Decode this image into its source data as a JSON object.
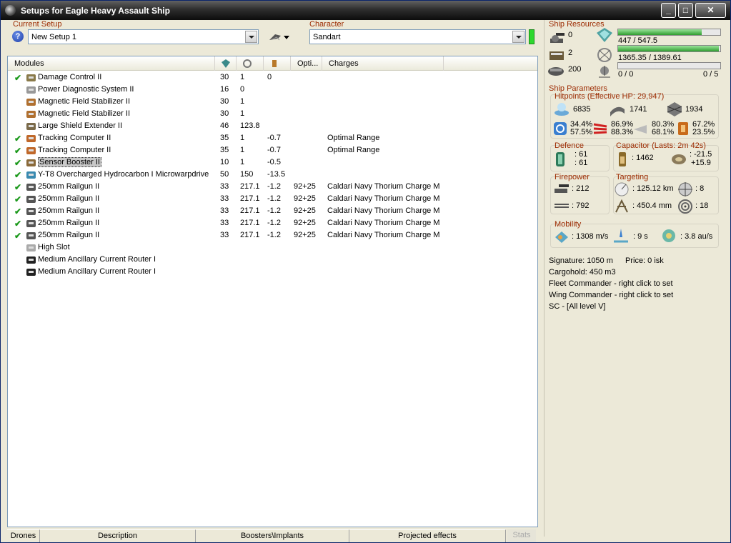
{
  "window": {
    "title": "Setups for Eagle Heavy Assault Ship"
  },
  "setup": {
    "label": "Current Setup",
    "value": "New Setup 1"
  },
  "character": {
    "label": "Character",
    "value": "Sandart"
  },
  "modules": {
    "headers": [
      "Modules",
      "",
      "",
      "",
      "Opti...",
      "Charges"
    ],
    "rows": [
      {
        "active": true,
        "name": "Damage Control II",
        "cpu": "30",
        "pg": "1",
        "cap": "0",
        "opt": "",
        "charge": "",
        "icon": "damage-control-icon"
      },
      {
        "active": false,
        "name": "Power Diagnostic System II",
        "cpu": "16",
        "pg": "0",
        "cap": "",
        "opt": "",
        "charge": "",
        "icon": "power-diagnostic-icon"
      },
      {
        "active": false,
        "name": "Magnetic Field Stabilizer II",
        "cpu": "30",
        "pg": "1",
        "cap": "",
        "opt": "",
        "charge": "",
        "icon": "magnetic-stabilizer-icon"
      },
      {
        "active": false,
        "name": "Magnetic Field Stabilizer II",
        "cpu": "30",
        "pg": "1",
        "cap": "",
        "opt": "",
        "charge": "",
        "icon": "magnetic-stabilizer-icon"
      },
      {
        "active": false,
        "name": "Large Shield Extender II",
        "cpu": "46",
        "pg": "123.8",
        "cap": "",
        "opt": "",
        "charge": "",
        "icon": "shield-extender-icon"
      },
      {
        "active": true,
        "name": "Tracking Computer II",
        "cpu": "35",
        "pg": "1",
        "cap": "-0.7",
        "opt": "",
        "charge": "Optimal Range",
        "icon": "tracking-computer-icon"
      },
      {
        "active": true,
        "name": "Tracking Computer II",
        "cpu": "35",
        "pg": "1",
        "cap": "-0.7",
        "opt": "",
        "charge": "Optimal Range",
        "icon": "tracking-computer-icon"
      },
      {
        "active": true,
        "name": "Sensor Booster II",
        "cpu": "10",
        "pg": "1",
        "cap": "-0.5",
        "opt": "",
        "charge": "",
        "icon": "sensor-booster-icon",
        "selected": true
      },
      {
        "active": true,
        "name": "Y-T8 Overcharged Hydrocarbon I Microwarpdrive",
        "cpu": "50",
        "pg": "150",
        "cap": "-13.5",
        "opt": "",
        "charge": "",
        "icon": "microwarpdrive-icon"
      },
      {
        "active": true,
        "name": "250mm Railgun II",
        "cpu": "33",
        "pg": "217.1",
        "cap": "-1.2",
        "opt": "92+25",
        "charge": "Caldari Navy Thorium Charge M",
        "icon": "railgun-icon"
      },
      {
        "active": true,
        "name": "250mm Railgun II",
        "cpu": "33",
        "pg": "217.1",
        "cap": "-1.2",
        "opt": "92+25",
        "charge": "Caldari Navy Thorium Charge M",
        "icon": "railgun-icon"
      },
      {
        "active": true,
        "name": "250mm Railgun II",
        "cpu": "33",
        "pg": "217.1",
        "cap": "-1.2",
        "opt": "92+25",
        "charge": "Caldari Navy Thorium Charge M",
        "icon": "railgun-icon"
      },
      {
        "active": true,
        "name": "250mm Railgun II",
        "cpu": "33",
        "pg": "217.1",
        "cap": "-1.2",
        "opt": "92+25",
        "charge": "Caldari Navy Thorium Charge M",
        "icon": "railgun-icon"
      },
      {
        "active": true,
        "name": "250mm Railgun II",
        "cpu": "33",
        "pg": "217.1",
        "cap": "-1.2",
        "opt": "92+25",
        "charge": "Caldari Navy Thorium Charge M",
        "icon": "railgun-icon"
      },
      {
        "active": false,
        "name": "High Slot",
        "cpu": "",
        "pg": "",
        "cap": "",
        "opt": "",
        "charge": "",
        "icon": "high-slot-icon"
      },
      {
        "active": false,
        "name": "Medium Ancillary Current Router I",
        "cpu": "",
        "pg": "",
        "cap": "",
        "opt": "",
        "charge": "",
        "icon": "rig-icon"
      },
      {
        "active": false,
        "name": "Medium Ancillary Current Router I",
        "cpu": "",
        "pg": "",
        "cap": "",
        "opt": "",
        "charge": "",
        "icon": "rig-icon"
      }
    ]
  },
  "tabs": [
    "Drones",
    "Description",
    "Boosters\\Implants",
    "Projected effects",
    "Stats"
  ],
  "resources": {
    "label": "Ship Resources",
    "turrets": "0",
    "launchers": "2",
    "calibration": "200",
    "cpu": "447 / 547.5",
    "cpu_fill": 0.816,
    "powergrid": "1365.35 / 1389.61",
    "powergrid_fill": 0.983,
    "drone_bay": "0 / 0",
    "drone_bw": "0 / 5",
    "drone_fill": 0
  },
  "params": {
    "label": "Ship Parameters",
    "hitpoints": "Hitpoints (Effective HP: 29,947)",
    "shield_hp": "6835",
    "armor_hp": "1741",
    "structure_hp": "1934",
    "shield_em": "34.4%",
    "shield_th": "57.5%",
    "armor_em": "86.9%",
    "armor_th": "88.3%",
    "kin_a": "80.3%",
    "kin_b": "68.1%",
    "exp_a": "67.2%",
    "exp_b": "23.5%",
    "defence_label": "Defence",
    "def_a": ": 61",
    "def_b": ": 61",
    "capacitor_label": "Capacitor (Lasts: 2m 42s)",
    "cap_amount": ": 1462",
    "cap_use": ": -21.5",
    "cap_regen": "+15.9",
    "firepower_label": "Firepower",
    "turret_dps": ": 212",
    "volley": ": 792",
    "targeting_label": "Targeting",
    "range": ": 125.12 km",
    "max_targets": ": 8",
    "scan_res": ": 450.4 mm",
    "sensor": ": 18",
    "mobility_label": "Mobility",
    "speed": ": 1308 m/s",
    "align": ": 9 s",
    "warp": ": 3.8 au/s"
  },
  "summary": {
    "signature": "Signature: 1050 m",
    "price": "Price: 0 isk",
    "cargohold": "Cargohold: 450 m3",
    "fleet": "Fleet Commander - right click to set",
    "wing": "Wing Commander - right click to set",
    "sc": "SC - [All level V]"
  }
}
